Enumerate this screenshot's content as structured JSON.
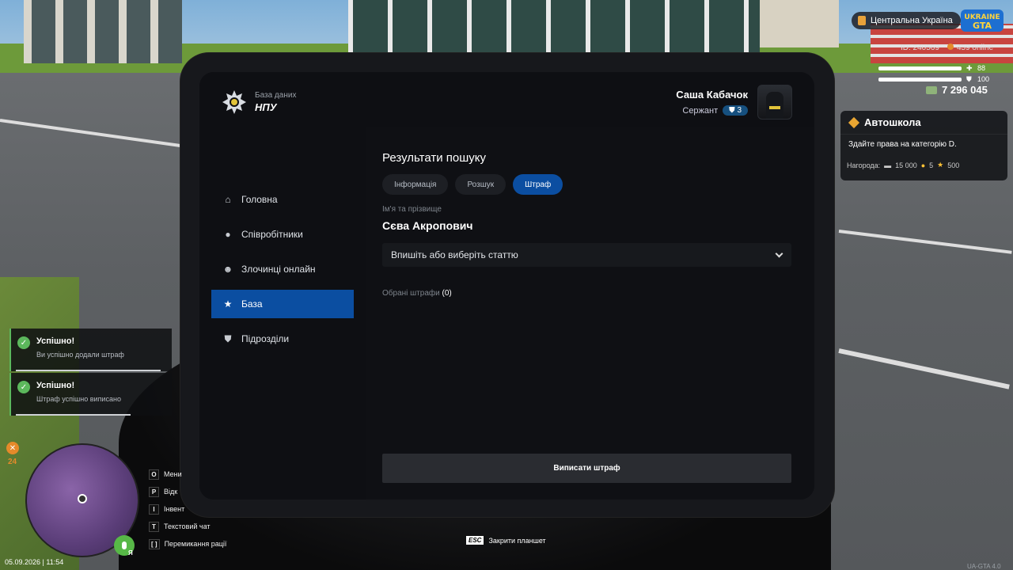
{
  "hud": {
    "region": "Центральна Україна",
    "logo_text": "UKRAINE GTA",
    "player_id": "ID: 240569",
    "online": "459 online",
    "health": "88",
    "armor": "100",
    "money": "7 296 045"
  },
  "quest": {
    "title": "Автошкола",
    "description": "Здайте права на категорію D.",
    "reward_label": "Нагорода:",
    "reward_cash": "15 000",
    "reward_coins": "5",
    "reward_stars": "500"
  },
  "tablet": {
    "brand_sub": "База даних",
    "brand_name": "НПУ",
    "user": {
      "name": "Саша Кабачок",
      "rank": "Сержант",
      "level": "3"
    },
    "nav": [
      {
        "label": "Головна",
        "icon": "home-icon"
      },
      {
        "label": "Співробітники",
        "icon": "people-icon"
      },
      {
        "label": "Злочинці онлайн",
        "icon": "criminal-icon"
      },
      {
        "label": "База",
        "icon": "star-icon"
      },
      {
        "label": "Підрозділи",
        "icon": "shield-icon"
      }
    ],
    "active_nav": "База",
    "section_title": "Результати пошуку",
    "tabs": [
      "Інформація",
      "Розшук",
      "Штраф"
    ],
    "active_tab": "Штраф",
    "name_label": "Ім'я та прізвище",
    "person_name": "Сєва Акропович",
    "article_placeholder": "Впишіть або виберіть статтю",
    "selected_fines_label": "Обрані штрафи",
    "selected_fines_count": "(0)",
    "submit_label": "Виписати штраф"
  },
  "notifications": [
    {
      "title": "Успішно!",
      "text": "Ви успішно додали штраф",
      "progress": 0.95
    },
    {
      "title": "Успішно!",
      "text": "Штраф успішно виписано",
      "progress": 0.75
    }
  ],
  "hunger": "24",
  "hints": [
    {
      "key": "O",
      "label": "Мени"
    },
    {
      "key": "P",
      "label": "Відк"
    },
    {
      "key": "I",
      "label": "Інвент"
    },
    {
      "key": "T",
      "label": "Текстовий чат"
    },
    {
      "key": "[ ]",
      "label": "Перемикання рації"
    }
  ],
  "mic_label": "Я",
  "datetime": "05.09.2026 | 11:54",
  "esc_key": "ESC",
  "esc_label": "Закрити планшет",
  "version": "UA-GTA 4.0",
  "colors": {
    "accent": "#0b4ea1",
    "success": "#5cb85c",
    "gold": "#e9a632"
  }
}
